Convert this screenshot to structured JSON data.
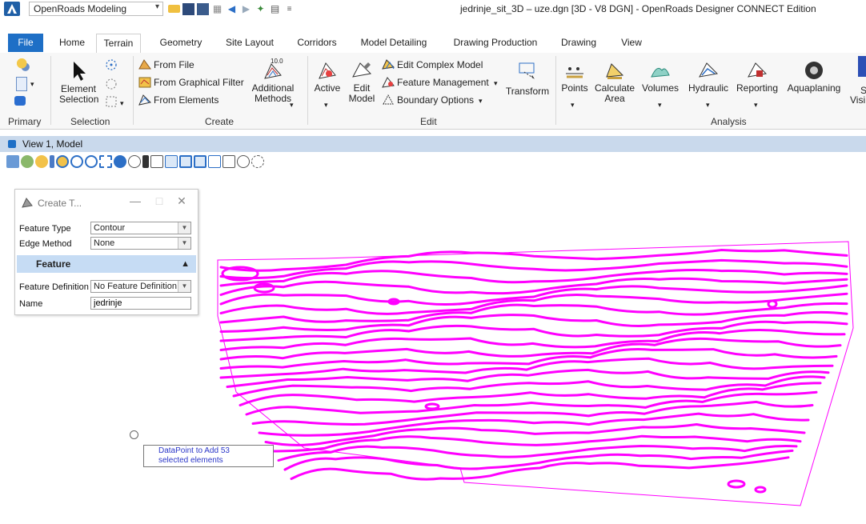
{
  "titlebar": {
    "workflow": "OpenRoads Modeling",
    "window_title": "jedrinje_sit_3D – uze.dgn [3D - V8 DGN] - OpenRoads Designer CONNECT Edition"
  },
  "tabs": [
    "File",
    "Home",
    "Terrain",
    "Geometry",
    "Site Layout",
    "Corridors",
    "Model Detailing",
    "Drawing Production",
    "Drawing",
    "View"
  ],
  "ribbon": {
    "groups": {
      "primary": "Primary",
      "selection": "Selection",
      "create": "Create",
      "edit": "Edit",
      "analysis": "Analysis"
    },
    "selection": {
      "element_selection": "Element Selection"
    },
    "create": {
      "from_file": "From File",
      "from_graphical_filter": "From Graphical Filter",
      "from_elements": "From Elements",
      "additional_methods": "Additional Methods",
      "additional_badge": "10.0"
    },
    "edit": {
      "active": "Active",
      "edit_model": "Edit Model",
      "edit_complex_model": "Edit Complex Model",
      "feature_management": "Feature Management",
      "boundary_options": "Boundary Options",
      "transform": "Transform"
    },
    "analysis": {
      "points": "Points",
      "calculate_area": "Calculate Area",
      "volumes": "Volumes",
      "hydraulic": "Hydraulic",
      "reporting": "Reporting",
      "aquaplaning": "Aquaplaning",
      "visibility_partial": "S",
      "visibility_partial2": "Visi"
    }
  },
  "view": {
    "title": "View 1, Model"
  },
  "dialog": {
    "title": "Create T...",
    "feature_type_label": "Feature Type",
    "feature_type_value": "Contour",
    "edge_method_label": "Edge Method",
    "edge_method_value": "None",
    "feature_section": "Feature",
    "feature_definition_label": "Feature Definition",
    "feature_definition_value": "No Feature Definition",
    "name_label": "Name",
    "name_value": "jedrinje"
  },
  "tooltip": {
    "text": "DataPoint to Add 53 selected elements"
  },
  "colors": {
    "contour": "#ff00ff",
    "file_tab": "#1e6fc6",
    "view_bar": "#c9d9ec",
    "feature_header": "#c6dcf4"
  }
}
